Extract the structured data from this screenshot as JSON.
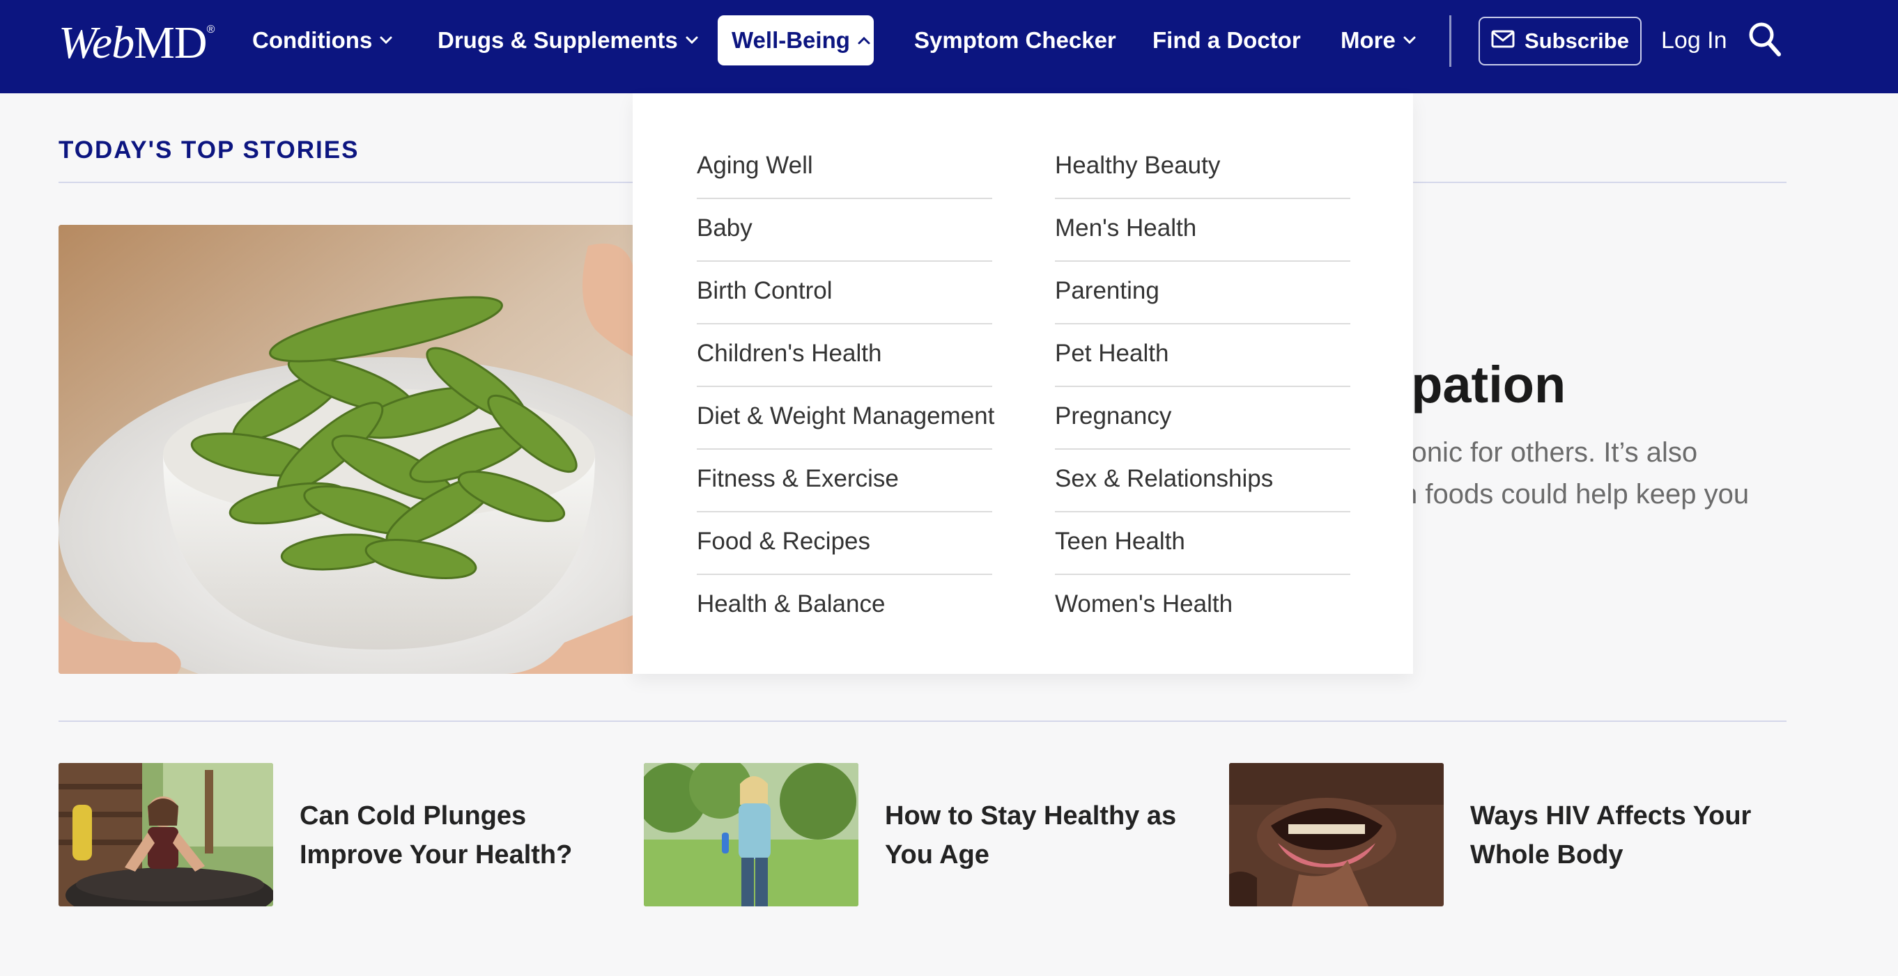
{
  "brand": {
    "logo_text_a": "Web",
    "logo_text_b": "MD",
    "logo_mark": "®"
  },
  "nav": {
    "items": [
      {
        "label": "Conditions",
        "has_chevron": true
      },
      {
        "label": "Drugs & Supplements",
        "has_chevron": true
      },
      {
        "label": "Well-Being",
        "has_chevron": true,
        "active": true
      },
      {
        "label": "Symptom Checker",
        "has_chevron": false
      },
      {
        "label": "Find a Doctor",
        "has_chevron": false
      },
      {
        "label": "More",
        "has_chevron": true
      }
    ],
    "subscribe_label": "Subscribe",
    "login_label": "Log In",
    "search_icon": "search-icon"
  },
  "top_stories": {
    "heading": "TODAY'S TOP STORIES",
    "hero": {
      "title_partial": "tipation",
      "desc_line_1": "hronic for others. It’s also",
      "desc_line_2": "n foods could help keep you",
      "image": "bowl of edamame pods"
    }
  },
  "wellbeing_menu": {
    "left_column": [
      "Aging Well",
      "Baby",
      "Birth Control",
      "Children's Health",
      "Diet & Weight Management",
      "Fitness & Exercise",
      "Food & Recipes",
      "Health & Balance"
    ],
    "right_column": [
      "Healthy Beauty",
      "Men's Health",
      "Parenting",
      "Pet Health",
      "Pregnancy",
      "Sex & Relationships",
      "Teen Health",
      "Women's Health"
    ]
  },
  "stories": [
    {
      "title": "Can Cold Plunges Improve Your Health?",
      "image": "woman in cold plunge tub outdoors"
    },
    {
      "title": "How to Stay Healthy as You Age",
      "image": "woman walking in park"
    },
    {
      "title": "Ways HIV Affects Your Whole Body",
      "image": "man showing gums"
    }
  ],
  "colors": {
    "nav_bg": "#0c1580",
    "accent": "#0c1580",
    "page_bg": "#f7f7f8",
    "divider": "#d4d7ea"
  }
}
